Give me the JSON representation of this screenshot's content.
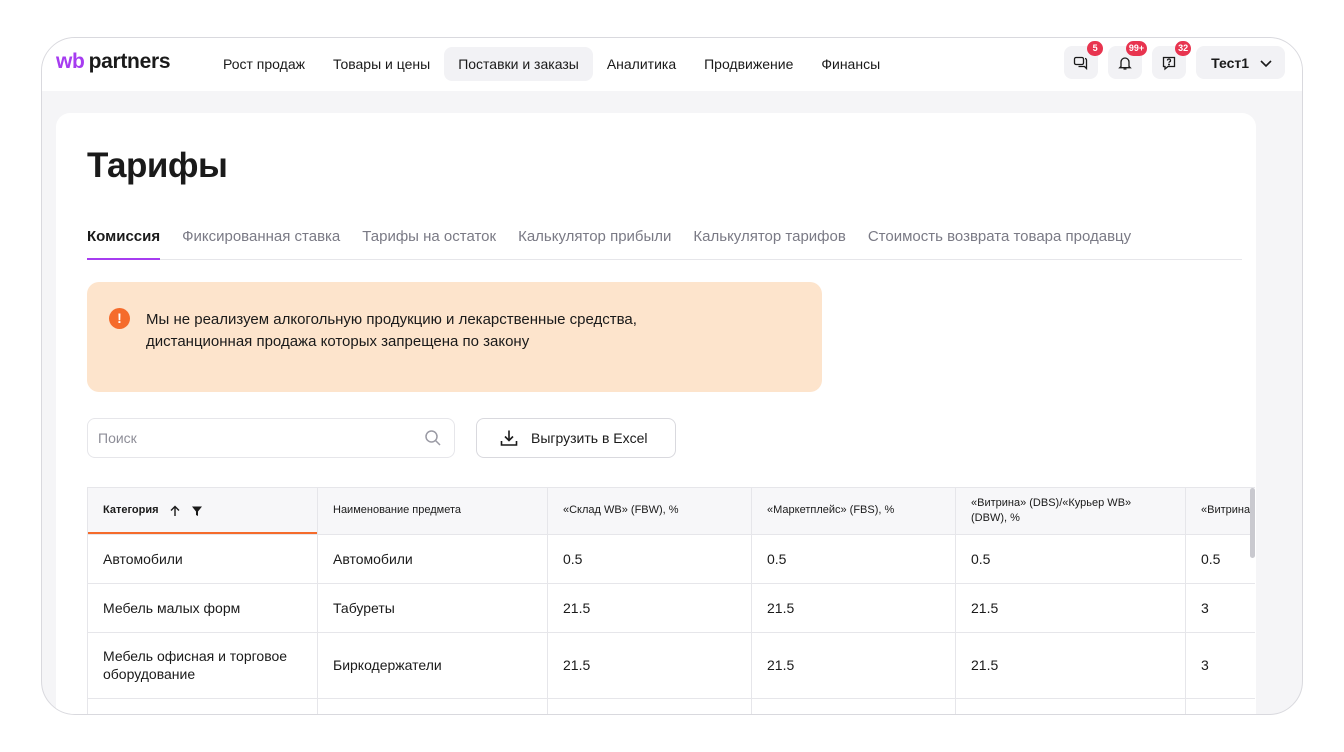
{
  "logo": {
    "wb": "wb",
    "partners": "partners"
  },
  "nav": [
    {
      "label": "Рост продаж",
      "active": false
    },
    {
      "label": "Товары и цены",
      "active": false
    },
    {
      "label": "Поставки и заказы",
      "active": true
    },
    {
      "label": "Аналитика",
      "active": false
    },
    {
      "label": "Продвижение",
      "active": false
    },
    {
      "label": "Финансы",
      "active": false
    }
  ],
  "header": {
    "chat_badge": "5",
    "notifications_badge": "99+",
    "help_badge": "32",
    "user_name": "Тест1"
  },
  "page_title": "Тарифы",
  "tabs": [
    {
      "label": "Комиссия",
      "active": true
    },
    {
      "label": "Фиксированная ставка",
      "active": false
    },
    {
      "label": "Тарифы на остаток",
      "active": false
    },
    {
      "label": "Калькулятор прибыли",
      "active": false
    },
    {
      "label": "Калькулятор тарифов",
      "active": false
    },
    {
      "label": "Стоимость возврата товара продавцу",
      "active": false
    }
  ],
  "alert": {
    "icon": "!",
    "line1": "Мы не реализуем алкогольную продукцию и лекарственные средства,",
    "line2": "дистанционная продажа которых запрещена по закону"
  },
  "search": {
    "placeholder": "Поиск",
    "value": ""
  },
  "excel_button": {
    "label": "Выгрузить в Excel"
  },
  "table": {
    "headers": [
      "Категория",
      "Наименование предмета",
      "«Склад WB» (FBW), %",
      "«Маркетплейс» (FBS), %",
      "«Витрина» (DBS)/«Курьер WB» (DBW), %",
      "«Витрина"
    ],
    "rows": [
      [
        "Автомобили",
        "Автомобили",
        "0.5",
        "0.5",
        "0.5",
        "0.5"
      ],
      [
        "Мебель малых форм",
        "Табуреты",
        "21.5",
        "21.5",
        "21.5",
        "3"
      ],
      [
        "Мебель офисная и торговое оборудование",
        "Биркодержатели",
        "21.5",
        "21.5",
        "21.5",
        "3"
      ]
    ]
  },
  "colors": {
    "brand": "#a63cf0",
    "badge": "#e8344f",
    "alert_bg": "#fde4cc",
    "alert_icon": "#f56b2b",
    "sort_underline": "#f56b2b"
  },
  "icons": {
    "chat": "chat-icon",
    "notifications": "bell-icon",
    "help": "help-icon",
    "user_chevron": "chevron-down-icon",
    "search": "search-icon",
    "download": "download-icon",
    "sort": "arrow-up-icon",
    "filter": "filter-icon",
    "alert": "warning-icon"
  }
}
